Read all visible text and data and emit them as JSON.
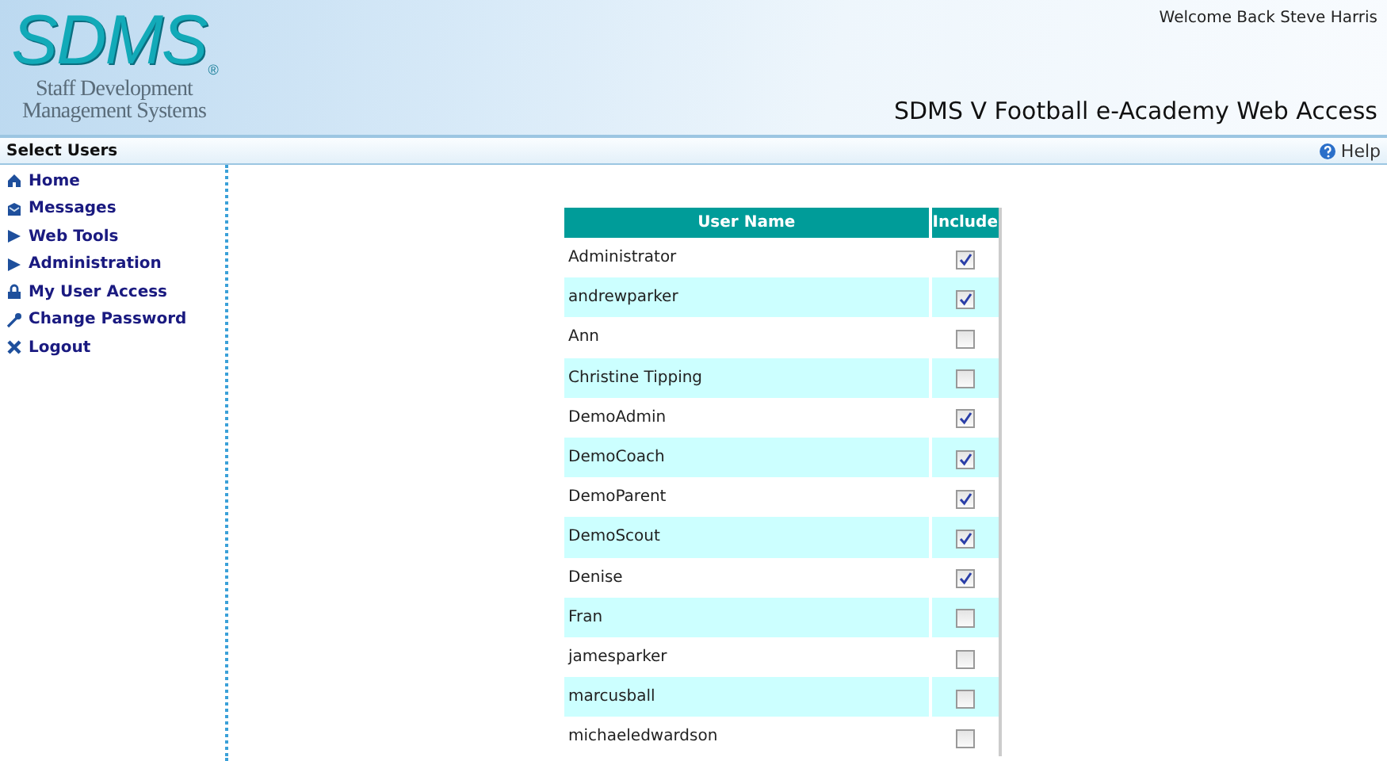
{
  "logo": {
    "mark": "SDMS",
    "registered": "®",
    "line_1": "Staff Development",
    "line_2": "Management Systems"
  },
  "welcome": "Welcome Back Steve Harris",
  "app_title": "SDMS V Football e-Academy Web Access",
  "page_title": "Select Users",
  "help": "Help",
  "sidebar": {
    "items": [
      {
        "label": "Home"
      },
      {
        "label": "Messages"
      },
      {
        "label": "Web Tools"
      },
      {
        "label": "Administration"
      },
      {
        "label": "My User Access"
      },
      {
        "label": "Change Password"
      },
      {
        "label": "Logout"
      }
    ]
  },
  "table": {
    "columns": [
      "User Name",
      "Include"
    ],
    "rows": [
      {
        "name": "Administrator",
        "checked": true
      },
      {
        "name": "andrewparker",
        "checked": true
      },
      {
        "name": "Ann",
        "checked": false
      },
      {
        "name": "Christine Tipping",
        "checked": false
      },
      {
        "name": "DemoAdmin",
        "checked": true
      },
      {
        "name": "DemoCoach",
        "checked": true
      },
      {
        "name": "DemoParent",
        "checked": true
      },
      {
        "name": "DemoScout",
        "checked": true
      },
      {
        "name": "Denise",
        "checked": true
      },
      {
        "name": "Fran",
        "checked": false
      },
      {
        "name": "jamesparker",
        "checked": false
      },
      {
        "name": "marcusball",
        "checked": false
      },
      {
        "name": "michaeledwardson",
        "checked": false
      }
    ]
  }
}
